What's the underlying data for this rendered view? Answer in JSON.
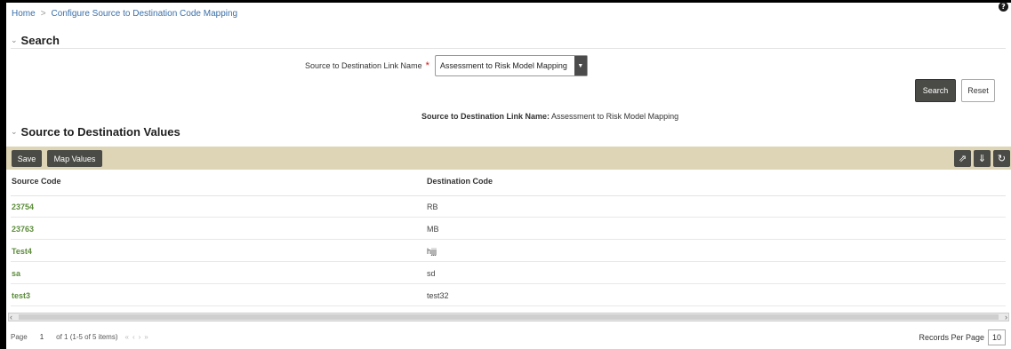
{
  "breadcrumb": {
    "home": "Home",
    "separator": ">",
    "current": "Configure Source to Destination Code Mapping"
  },
  "help_icon": "?",
  "search_section": {
    "title": "Search",
    "field_label": "Source to Destination Link Name",
    "required_mark": "*",
    "select_value": "Assessment to Risk Model Mapping",
    "search_button": "Search",
    "reset_button": "Reset"
  },
  "summary": {
    "label": "Source to Destination Link Name:",
    "value": "Assessment to Risk Model Mapping"
  },
  "values_section": {
    "title": "Source to Destination Values",
    "save_button": "Save",
    "map_values_button": "Map Values",
    "icons": [
      "export-icon",
      "import-icon",
      "refresh-icon"
    ]
  },
  "table": {
    "columns": [
      "Source Code",
      "Destination Code"
    ],
    "rows": [
      {
        "source": "23754",
        "destination": "RB"
      },
      {
        "source": "23763",
        "destination": "MB"
      },
      {
        "source": "Test4",
        "destination": "hjjj"
      },
      {
        "source": "sa",
        "destination": "sd"
      },
      {
        "source": "test3",
        "destination": "test32"
      }
    ]
  },
  "pagination": {
    "page_label": "Page",
    "page_number": "1",
    "summary": "of 1 (1-5 of 5 items)",
    "records_per_page_label": "Records Per Page",
    "records_per_page": "10"
  },
  "colors": {
    "toolbar_bg": "#ded5b7",
    "dark_button": "#4a4a46",
    "link_green": "#5b8c3a",
    "link_blue": "#3a6fa8"
  }
}
